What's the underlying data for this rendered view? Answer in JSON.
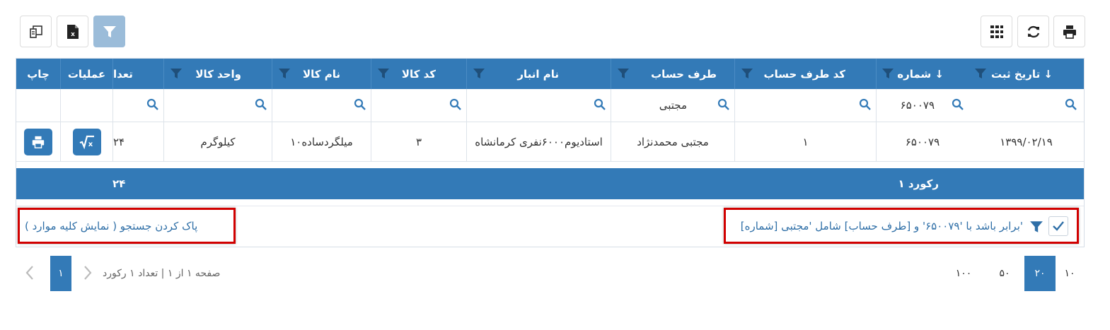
{
  "toolbar": {
    "left_buttons": [
      "column-chooser-icon",
      "excel-export-icon",
      "filter-icon"
    ],
    "right_buttons": [
      "grid-icon",
      "refresh-icon",
      "print-icon"
    ]
  },
  "columns": {
    "date": "تاریخ ثبت ↓",
    "number": "شماره ↓",
    "account_code": "کد طرف حساب",
    "account": "طرف حساب",
    "warehouse": "نام انبار",
    "item_code": "کد کالا",
    "item_name": "نام کالا",
    "unit": "واحد کالا",
    "qty": "تعدا",
    "ops": "عملیات",
    "print": "چاپ"
  },
  "search": {
    "number": "۶۵۰۰۷۹",
    "account": "مجتبی"
  },
  "row": {
    "date": "۱۳۹۹/۰۲/۱۹",
    "number": "۶۵۰۰۷۹",
    "account_code": "۱",
    "account": "مجتبی محمدنژاد",
    "warehouse": "استادیوم۶۰۰۰نفری کرمانشاه",
    "item_code": "۳",
    "item_name": "میلگردساده۱۰",
    "unit": "کیلوگرم",
    "qty": "۲۴"
  },
  "footer": {
    "record_count": "۱ رکورد",
    "qty_total": "۲۴"
  },
  "filter_summary": {
    "text": "[شماره] برابر باشد با '۶۵۰۰۷۹' و [طرف حساب] شامل 'مجتبی'",
    "clear_link": "پاک کردن جستجو ( نمایش کلیه موارد )"
  },
  "pager": {
    "page_sizes": [
      "۱۰",
      "۲۰",
      "۵۰",
      "۱۰۰"
    ],
    "active_page_size": "۲۰",
    "current_page": "۱",
    "info": "صفحه ۱ از ۱ | تعداد ۱ رکورد"
  },
  "colors": {
    "primary": "#337ab7",
    "highlight": "#d10000"
  }
}
